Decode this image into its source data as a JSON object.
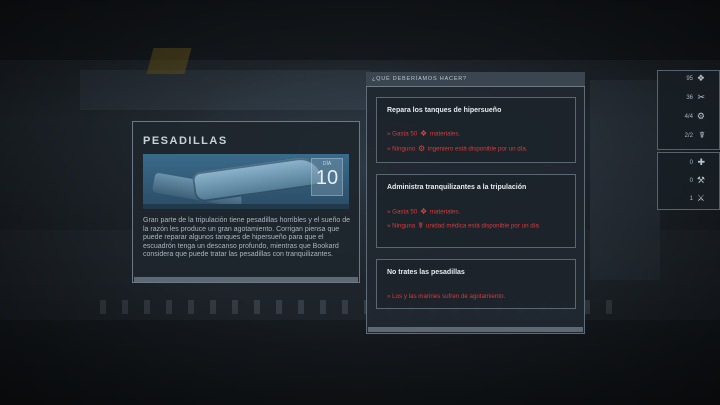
{
  "event": {
    "title": "PESADILLAS",
    "badge_label": "DÍA",
    "badge_value": "10",
    "description": "Gran parte de la tripulación tiene pesadillas horribles y el sueño de la razón les produce un gran agotamiento. Corrigan piensa que puede reparar algunos tanques de hipersueño para que el escuadrón tenga un descanso profundo, mientras que Bookard considera que puede tratar las pesadillas con tranquilizantes."
  },
  "options_panel": {
    "header": "¿QUÉ DEBERÍAMOS HACER?",
    "options": [
      {
        "title": "Repara los tanques de hipersueño",
        "requirements": [
          {
            "prefix": "» Gasta 50 ",
            "icon": "materials-icon",
            "suffix": " materiales."
          },
          {
            "prefix": "» Ninguno ",
            "icon": "engineer-icon",
            "suffix": " ingeniero está disponible por un día."
          }
        ]
      },
      {
        "title": "Administra tranquilizantes a la tripulación",
        "requirements": [
          {
            "prefix": "» Gasta 50 ",
            "icon": "materials-icon",
            "suffix": " materiales."
          },
          {
            "prefix": "» Ninguna ",
            "icon": "medical-icon",
            "suffix": " unidad médica está disponible por un día"
          }
        ]
      },
      {
        "title": "No trates las pesadillas",
        "requirements": [
          {
            "prefix": "» Los y las marines sufren de agotamiento.",
            "icon": "",
            "suffix": ""
          }
        ]
      }
    ]
  },
  "resources": {
    "top": [
      {
        "value": "95",
        "icon": "materials-icon"
      },
      {
        "value": "36",
        "icon": "tools-icon"
      },
      {
        "value": "4/4",
        "icon": "gears-icon"
      },
      {
        "value": "2/2",
        "icon": "medical-icon"
      }
    ],
    "bottom": [
      {
        "value": "0",
        "icon": "medkit-icon"
      },
      {
        "value": "0",
        "icon": "wrench-icon"
      },
      {
        "value": "1",
        "icon": "knife-icon"
      }
    ]
  },
  "colors": {
    "accent_red": "#d83a3a",
    "panel_border": "#5f6b76",
    "text_light": "#e6ecf0"
  }
}
